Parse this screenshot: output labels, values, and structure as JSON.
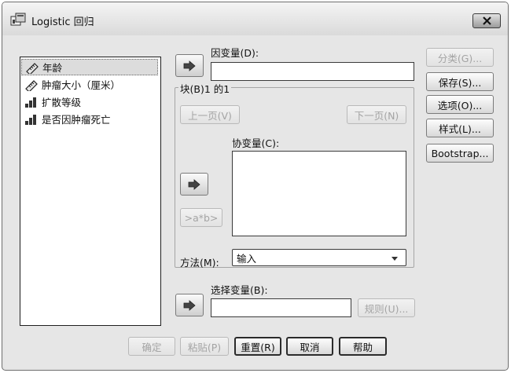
{
  "window": {
    "title": "Logistic 回归"
  },
  "variables": [
    {
      "label": "年龄",
      "icon": "scale-variable-icon",
      "selected": true
    },
    {
      "label": "肿瘤大小（厘米）",
      "icon": "scale-variable-icon",
      "selected": false
    },
    {
      "label": "扩散等级",
      "icon": "ordinal-variable-icon",
      "selected": false
    },
    {
      "label": "是否因肿瘤死亡",
      "icon": "ordinal-variable-icon",
      "selected": false
    }
  ],
  "dependent": {
    "label": "因变量(D):",
    "value": ""
  },
  "block": {
    "title": "块(B)1 的1",
    "prev_label": "上一页(V)",
    "next_label": "下一页(N)",
    "covariates_label": "协变量(C):",
    "interaction_label": ">a*b>",
    "method_label": "方法(M):",
    "method_value": "输入"
  },
  "selection": {
    "label": "选择变量(B):",
    "value": "",
    "rule_label": "规则(U)..."
  },
  "side_buttons": {
    "classify": "分类(G)...",
    "save": "保存(S)...",
    "options": "选项(O)...",
    "style": "样式(L)...",
    "bootstrap": "Bootstrap..."
  },
  "bottom_buttons": {
    "ok": "确定",
    "paste": "粘贴(P)",
    "reset": "重置(R)",
    "cancel": "取消",
    "help": "帮助"
  }
}
